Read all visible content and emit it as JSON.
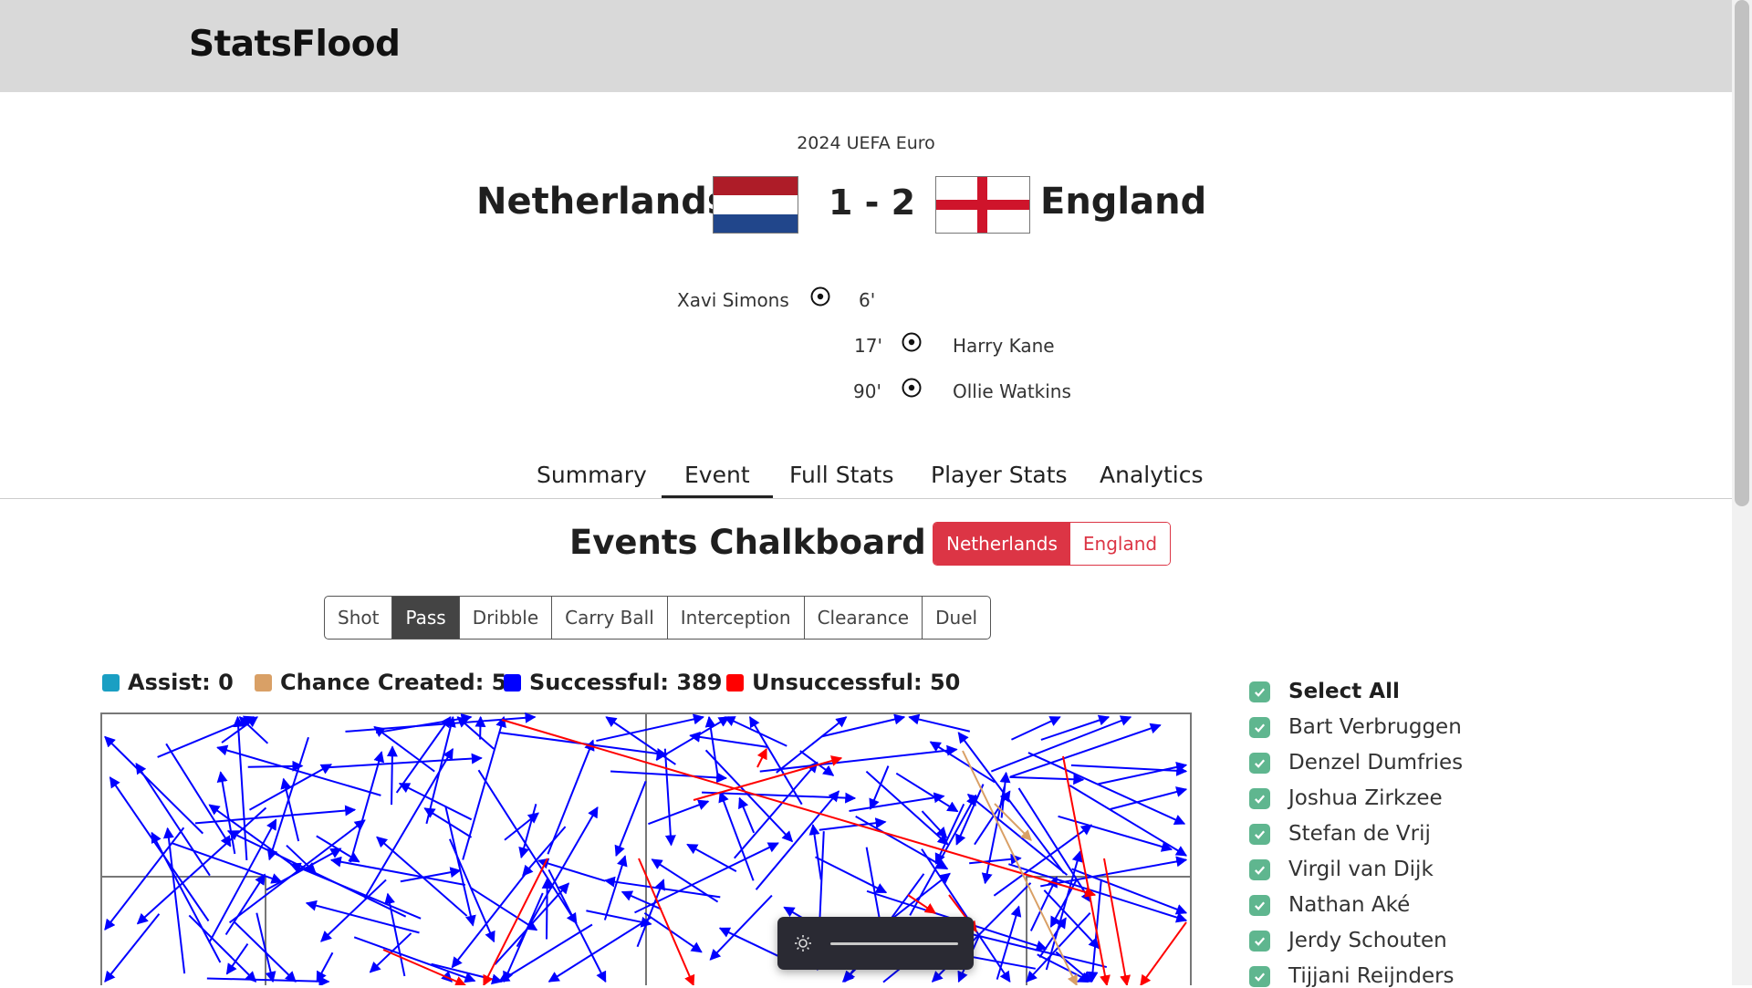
{
  "app": {
    "brand": "StatsFlood"
  },
  "match": {
    "competition": "2024 UEFA Euro",
    "home_team": "Netherlands",
    "away_team": "England",
    "score": "1 - 2",
    "goals": [
      {
        "side": "home",
        "player": "Xavi Simons",
        "minute": "6'"
      },
      {
        "side": "away",
        "player": "Harry Kane",
        "minute": "17'"
      },
      {
        "side": "away",
        "player": "Ollie Watkins",
        "minute": "90'"
      }
    ]
  },
  "tabs": [
    {
      "label": "Summary",
      "active": false
    },
    {
      "label": "Event",
      "active": true
    },
    {
      "label": "Full Stats",
      "active": false
    },
    {
      "label": "Player Stats",
      "active": false
    },
    {
      "label": "Analytics",
      "active": false
    }
  ],
  "chalkboard": {
    "title": "Events Chalkboard",
    "team_toggle": {
      "selected": "Netherlands",
      "other": "England"
    },
    "event_types": [
      "Shot",
      "Pass",
      "Dribble",
      "Carry Ball",
      "Interception",
      "Clearance",
      "Duel"
    ],
    "selected_event_type": "Pass",
    "legend": [
      {
        "label": "Assist: 0",
        "color": "#1a9fc3"
      },
      {
        "label": "Chance Created: 5",
        "color": "#d9a066"
      },
      {
        "label": "Successful: 389",
        "color": "#0000ff"
      },
      {
        "label": "Unsuccessful: 50",
        "color": "#ff0000"
      }
    ],
    "colors": {
      "successful": "#0000ff",
      "unsuccessful": "#ff0000",
      "chance_created": "#d9a066"
    }
  },
  "players": {
    "select_all_label": "Select All",
    "list": [
      "Bart Verbruggen",
      "Denzel Dumfries",
      "Joshua Zirkzee",
      "Stefan de Vrij",
      "Virgil van Dijk",
      "Nathan Aké",
      "Jerdy Schouten",
      "Tijjani Reijnders"
    ]
  },
  "icons": {
    "goal": "soccer-ball-icon",
    "brightness": "sun-icon",
    "check": "check-icon"
  }
}
